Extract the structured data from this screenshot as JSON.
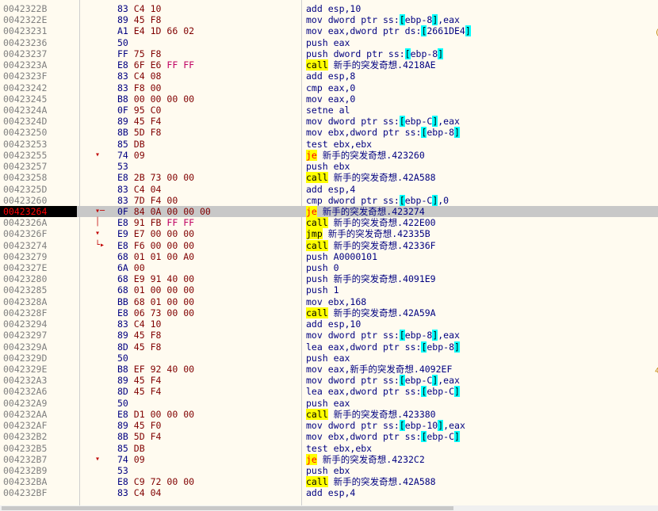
{
  "current_address": "00423264",
  "edge_glyphs": [
    "(",
    "4"
  ],
  "rows": [
    {
      "addr": "0042322B",
      "arrow": "",
      "bytes": "83 C4 10",
      "mn": "add",
      "ops": "esp,10"
    },
    {
      "addr": "0042322E",
      "arrow": "",
      "bytes": "89 45 F8",
      "mn": "mov",
      "ops": "dword ptr ss:[ebp-8],eax"
    },
    {
      "addr": "00423231",
      "arrow": "",
      "bytes": "A1 E4 1D 66 02",
      "mn": "mov",
      "ops": "eax,dword ptr ds:[2661DE4]"
    },
    {
      "addr": "00423236",
      "arrow": "",
      "bytes": "50",
      "mn": "push",
      "ops": "eax"
    },
    {
      "addr": "00423237",
      "arrow": "",
      "bytes": "FF 75 F8",
      "mn": "push",
      "ops": "dword ptr ss:[ebp-8]"
    },
    {
      "addr": "0042323A",
      "arrow": "",
      "bytes": "E8 6F E6 FF FF",
      "mn": "call",
      "ops": "新手的突发奇想.4218AE"
    },
    {
      "addr": "0042323F",
      "arrow": "",
      "bytes": "83 C4 08",
      "mn": "add",
      "ops": "esp,8"
    },
    {
      "addr": "00423242",
      "arrow": "",
      "bytes": "83 F8 00",
      "mn": "cmp",
      "ops": "eax,0"
    },
    {
      "addr": "00423245",
      "arrow": "",
      "bytes": "B8 00 00 00 00",
      "mn": "mov",
      "ops": "eax,0"
    },
    {
      "addr": "0042324A",
      "arrow": "",
      "bytes": "0F 95 C0",
      "mn": "setne",
      "ops": "al"
    },
    {
      "addr": "0042324D",
      "arrow": "",
      "bytes": "89 45 F4",
      "mn": "mov",
      "ops": "dword ptr ss:[ebp-C],eax"
    },
    {
      "addr": "00423250",
      "arrow": "",
      "bytes": "8B 5D F8",
      "mn": "mov",
      "ops": "ebx,dword ptr ss:[ebp-8]"
    },
    {
      "addr": "00423253",
      "arrow": "",
      "bytes": "85 DB",
      "mn": "test",
      "ops": "ebx,ebx"
    },
    {
      "addr": "00423255",
      "arrow": "v",
      "bytes": "74 09",
      "mn": "je",
      "ops": "新手的突发奇想.423260"
    },
    {
      "addr": "00423257",
      "arrow": "",
      "bytes": "53",
      "mn": "push",
      "ops": "ebx"
    },
    {
      "addr": "00423258",
      "arrow": "",
      "bytes": "E8 2B 73 00 00",
      "mn": "call",
      "ops": "新手的突发奇想.42A588"
    },
    {
      "addr": "0042325D",
      "arrow": "",
      "bytes": "83 C4 04",
      "mn": "add",
      "ops": "esp,4"
    },
    {
      "addr": "00423260",
      "arrow": "",
      "bytes": "83 7D F4 00",
      "mn": "cmp",
      "ops": "dword ptr ss:[ebp-C],0"
    },
    {
      "addr": "00423264",
      "arrow": "v--",
      "bytes": "0F 84 0A 00 00 00",
      "mn": "je",
      "ops": "新手的突发奇想.423274"
    },
    {
      "addr": "0042326A",
      "arrow": "|",
      "bytes": "E8 91 FB FF FF",
      "mn": "call",
      "ops": "新手的突发奇想.422E00"
    },
    {
      "addr": "0042326F",
      "arrow": "v",
      "bytes": "E9 E7 00 00 00",
      "mn": "jmp",
      "ops": "新手的突发奇想.42335B"
    },
    {
      "addr": "00423274",
      "arrow": "L>",
      "bytes": "E8 F6 00 00 00",
      "mn": "call",
      "ops": "新手的突发奇想.42336F"
    },
    {
      "addr": "00423279",
      "arrow": "",
      "bytes": "68 01 01 00 A0",
      "mn": "push",
      "ops": "A0000101"
    },
    {
      "addr": "0042327E",
      "arrow": "",
      "bytes": "6A 00",
      "mn": "push",
      "ops": "0"
    },
    {
      "addr": "00423280",
      "arrow": "",
      "bytes": "68 E9 91 40 00",
      "mn": "push",
      "ops": "新手的突发奇想.4091E9"
    },
    {
      "addr": "00423285",
      "arrow": "",
      "bytes": "68 01 00 00 00",
      "mn": "push",
      "ops": "1"
    },
    {
      "addr": "0042328A",
      "arrow": "",
      "bytes": "BB 68 01 00 00",
      "mn": "mov",
      "ops": "ebx,168"
    },
    {
      "addr": "0042328F",
      "arrow": "",
      "bytes": "E8 06 73 00 00",
      "mn": "call",
      "ops": "新手的突发奇想.42A59A"
    },
    {
      "addr": "00423294",
      "arrow": "",
      "bytes": "83 C4 10",
      "mn": "add",
      "ops": "esp,10"
    },
    {
      "addr": "00423297",
      "arrow": "",
      "bytes": "89 45 F8",
      "mn": "mov",
      "ops": "dword ptr ss:[ebp-8],eax"
    },
    {
      "addr": "0042329A",
      "arrow": "",
      "bytes": "8D 45 F8",
      "mn": "lea",
      "ops": "eax,dword ptr ss:[ebp-8]"
    },
    {
      "addr": "0042329D",
      "arrow": "",
      "bytes": "50",
      "mn": "push",
      "ops": "eax"
    },
    {
      "addr": "0042329E",
      "arrow": "",
      "bytes": "B8 EF 92 40 00",
      "mn": "mov",
      "ops": "eax,新手的突发奇想.4092EF"
    },
    {
      "addr": "004232A3",
      "arrow": "",
      "bytes": "89 45 F4",
      "mn": "mov",
      "ops": "dword ptr ss:[ebp-C],eax"
    },
    {
      "addr": "004232A6",
      "arrow": "",
      "bytes": "8D 45 F4",
      "mn": "lea",
      "ops": "eax,dword ptr ss:[ebp-C]"
    },
    {
      "addr": "004232A9",
      "arrow": "",
      "bytes": "50",
      "mn": "push",
      "ops": "eax"
    },
    {
      "addr": "004232AA",
      "arrow": "",
      "bytes": "E8 D1 00 00 00",
      "mn": "call",
      "ops": "新手的突发奇想.423380"
    },
    {
      "addr": "004232AF",
      "arrow": "",
      "bytes": "89 45 F0",
      "mn": "mov",
      "ops": "dword ptr ss:[ebp-10],eax"
    },
    {
      "addr": "004232B2",
      "arrow": "",
      "bytes": "8B 5D F4",
      "mn": "mov",
      "ops": "ebx,dword ptr ss:[ebp-C]"
    },
    {
      "addr": "004232B5",
      "arrow": "",
      "bytes": "85 DB",
      "mn": "test",
      "ops": "ebx,ebx"
    },
    {
      "addr": "004232B7",
      "arrow": "v",
      "bytes": "74 09",
      "mn": "je",
      "ops": "新手的突发奇想.4232C2"
    },
    {
      "addr": "004232B9",
      "arrow": "",
      "bytes": "53",
      "mn": "push",
      "ops": "ebx"
    },
    {
      "addr": "004232BA",
      "arrow": "",
      "bytes": "E8 C9 72 00 00",
      "mn": "call",
      "ops": "新手的突发奇想.42A588"
    },
    {
      "addr": "004232BF",
      "arrow": "",
      "bytes": "83 C4 04",
      "mn": "add",
      "ops": "esp,4"
    }
  ]
}
